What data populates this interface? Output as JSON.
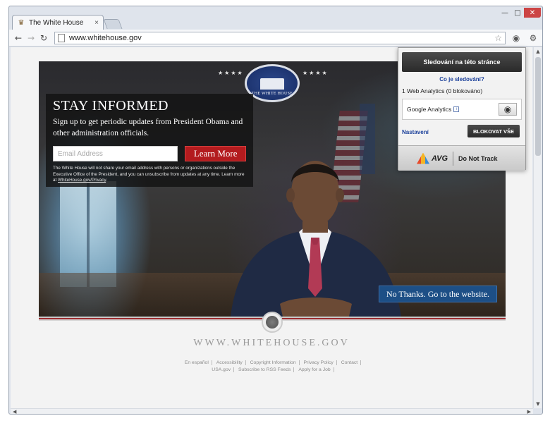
{
  "browser": {
    "tab_title": "The White House",
    "tab_close": "×",
    "url": "www.whitehouse.gov",
    "window_controls": [
      "—",
      "□",
      "✕"
    ]
  },
  "hero": {
    "seal_text": "THE WHITE HOUSE",
    "stars_left": "★★★★",
    "stars_right": "★★★★",
    "signup": {
      "title": "STAY INFORMED",
      "subtitle": "Sign up to get periodic updates from President Obama and other administration officials.",
      "email_placeholder": "Email Address",
      "button": "Learn More",
      "privacy_text": "The White House will not share your email address with persons or organizations outside the Executive Office of the President, and you can unsubscribe from updates at any time. Learn more at",
      "privacy_link": "WhiteHouse.gov/Privacy",
      "privacy_end": "."
    },
    "no_thanks": "No Thanks. Go to the website."
  },
  "footer": {
    "domain": "WWW.WHITEHOUSE.GOV",
    "links_row1": [
      "En español",
      "Accessibility",
      "Copyright Information",
      "Privacy Policy",
      "Contact"
    ],
    "links_row2": [
      "USA.gov",
      "Subscribe to RSS Feeds",
      "Apply for a Job"
    ]
  },
  "popup": {
    "track_button": "Sledování na této stránce",
    "what_link": "Co je sledování?",
    "summary": "1 Web Analytics (0 blokováno)",
    "tracker_name": "Google Analytics",
    "settings": "Nastavení",
    "block_all": "BLOKOVAT VŠE",
    "brand": "AVG",
    "dnt": "Do Not Track"
  }
}
